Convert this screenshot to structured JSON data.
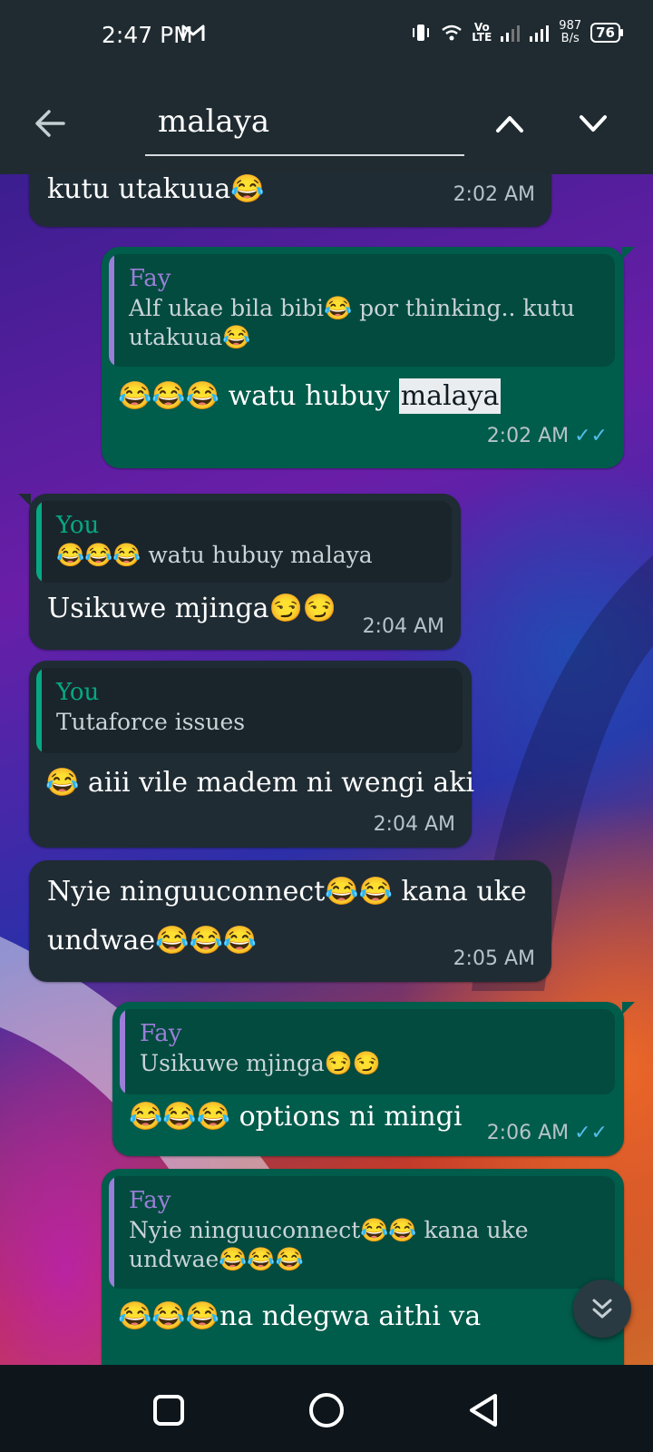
{
  "status_bar": {
    "time": "2:47 PM",
    "net_speed_value": "987",
    "net_speed_unit": "B/s",
    "network_label_top": "Vo",
    "network_label_bottom": "LTE",
    "battery": "76"
  },
  "search": {
    "query": "malaya"
  },
  "messages": [
    {
      "text": "kutu utakuua😂",
      "time": "2:02 AM"
    },
    {
      "quote_author": "Fay",
      "quote_line1": "Alf ukae bila bibi😂 por thinking.. kutu",
      "quote_line2": "utakuua😂",
      "text_before": "😂😂😂 watu hubuy ",
      "highlight": "malaya",
      "time": "2:02 AM"
    },
    {
      "quote_author": "You",
      "quote_text": "😂😂😂 watu hubuy malaya",
      "text": "Usikuwe mjinga😏😏",
      "time": "2:04 AM"
    },
    {
      "quote_author": "You",
      "quote_text": "Tutaforce issues",
      "text": "😂 aiii vile madem ni wengi aki",
      "time": "2:04 AM"
    },
    {
      "line1": "Nyie ninguuconnect😂😂 kana uke",
      "line2": "undwae😂😂😂",
      "time": "2:05 AM"
    },
    {
      "quote_author": "Fay",
      "quote_text": "Usikuwe mjinga😏😏",
      "text": "😂😂😂 options ni mingi",
      "time": "2:06 AM"
    },
    {
      "quote_author": "Fay",
      "quote_line1": "Nyie ninguuconnect😂😂 kana uke",
      "quote_line2": "undwae😂😂😂",
      "text": "😂😂😂na ndegwa aithi va"
    }
  ],
  "ticks": "✓✓",
  "icons": {
    "back": "arrow-left-icon",
    "up": "chevron-up-icon",
    "down": "chevron-down-icon",
    "scroll": "double-chevron-down-icon",
    "nav_recent": "square-icon",
    "nav_home": "circle-icon",
    "nav_back": "triangle-icon"
  },
  "colors": {
    "incoming_bubble": "#1f2c34",
    "outgoing_bubble": "#005c4b",
    "fay_name": "#9b7ed9",
    "you_name": "#06a884",
    "read_ticks": "#53bdeb"
  }
}
